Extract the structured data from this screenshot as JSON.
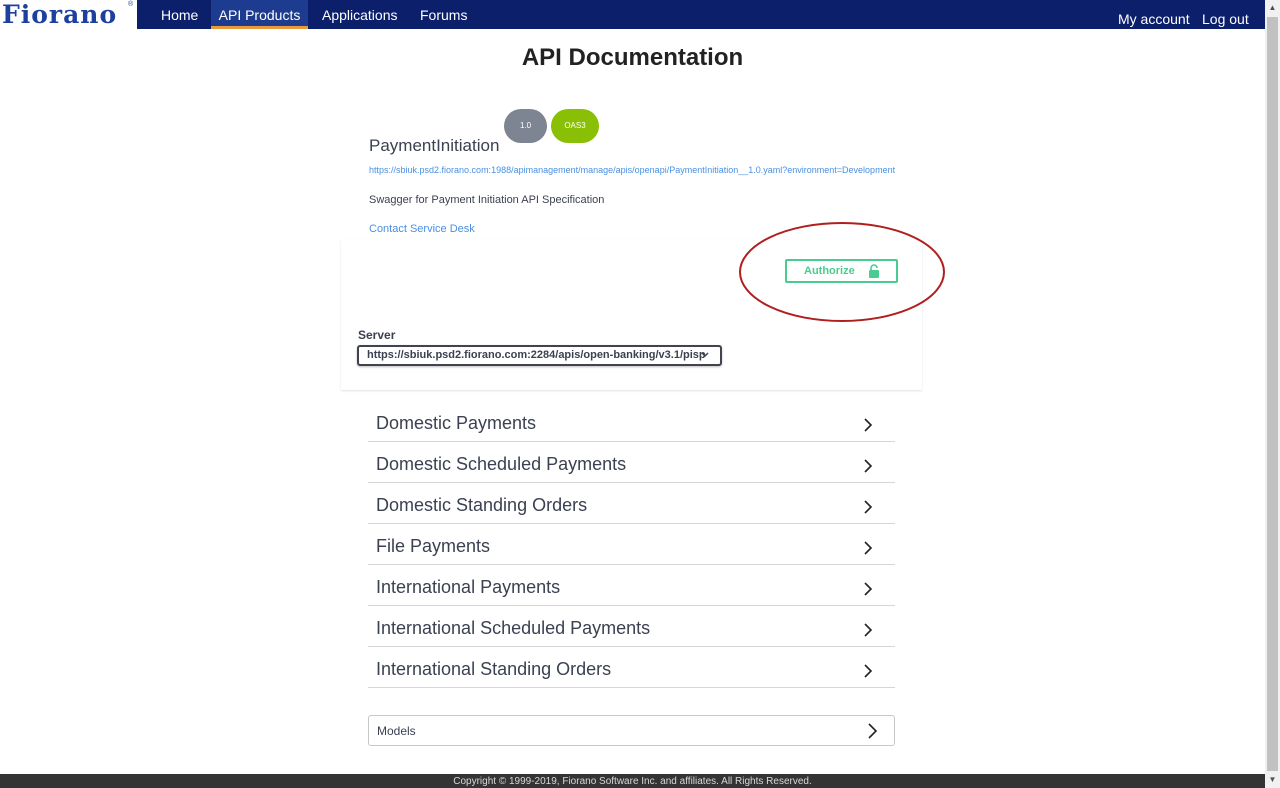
{
  "nav": {
    "logo_text": "Fiorano",
    "links": [
      {
        "label": "Home"
      },
      {
        "label": "API Products"
      },
      {
        "label": "Applications"
      },
      {
        "label": "Forums"
      }
    ],
    "right": [
      {
        "label": "My account"
      },
      {
        "label": "Log out"
      }
    ],
    "active_accent": "#e89a3c",
    "bar_color": "#0b1f6b"
  },
  "page_title": "API Documentation",
  "api": {
    "title": "PaymentInitiation",
    "version_badge": "1.0",
    "oas_badge": "OAS3",
    "spec_url": "https://sbiuk.psd2.fiorano.com:1988/apimanagement/manage/apis/openapi/PaymentInitiation__1.0.yaml?environment=Development",
    "description": "Swagger for Payment Initiation API Specification",
    "contact_link": "Contact Service Desk"
  },
  "authorize": {
    "label": "Authorize",
    "icon": "unlock-icon",
    "color": "#49cc90",
    "highlight_color": "#b01e1e"
  },
  "server": {
    "label": "Server",
    "selected": "https://sbiuk.psd2.fiorano.com:2284/apis/open-banking/v3.1/pisp"
  },
  "tags": [
    {
      "label": "Domestic Payments"
    },
    {
      "label": "Domestic Scheduled Payments"
    },
    {
      "label": "Domestic Standing Orders"
    },
    {
      "label": "File Payments"
    },
    {
      "label": "International Payments"
    },
    {
      "label": "International Scheduled Payments"
    },
    {
      "label": "International Standing Orders"
    }
  ],
  "models": {
    "label": "Models"
  },
  "footer": "Copyright © 1999-2019, Fiorano Software Inc. and affiliates. All Rights Reserved."
}
